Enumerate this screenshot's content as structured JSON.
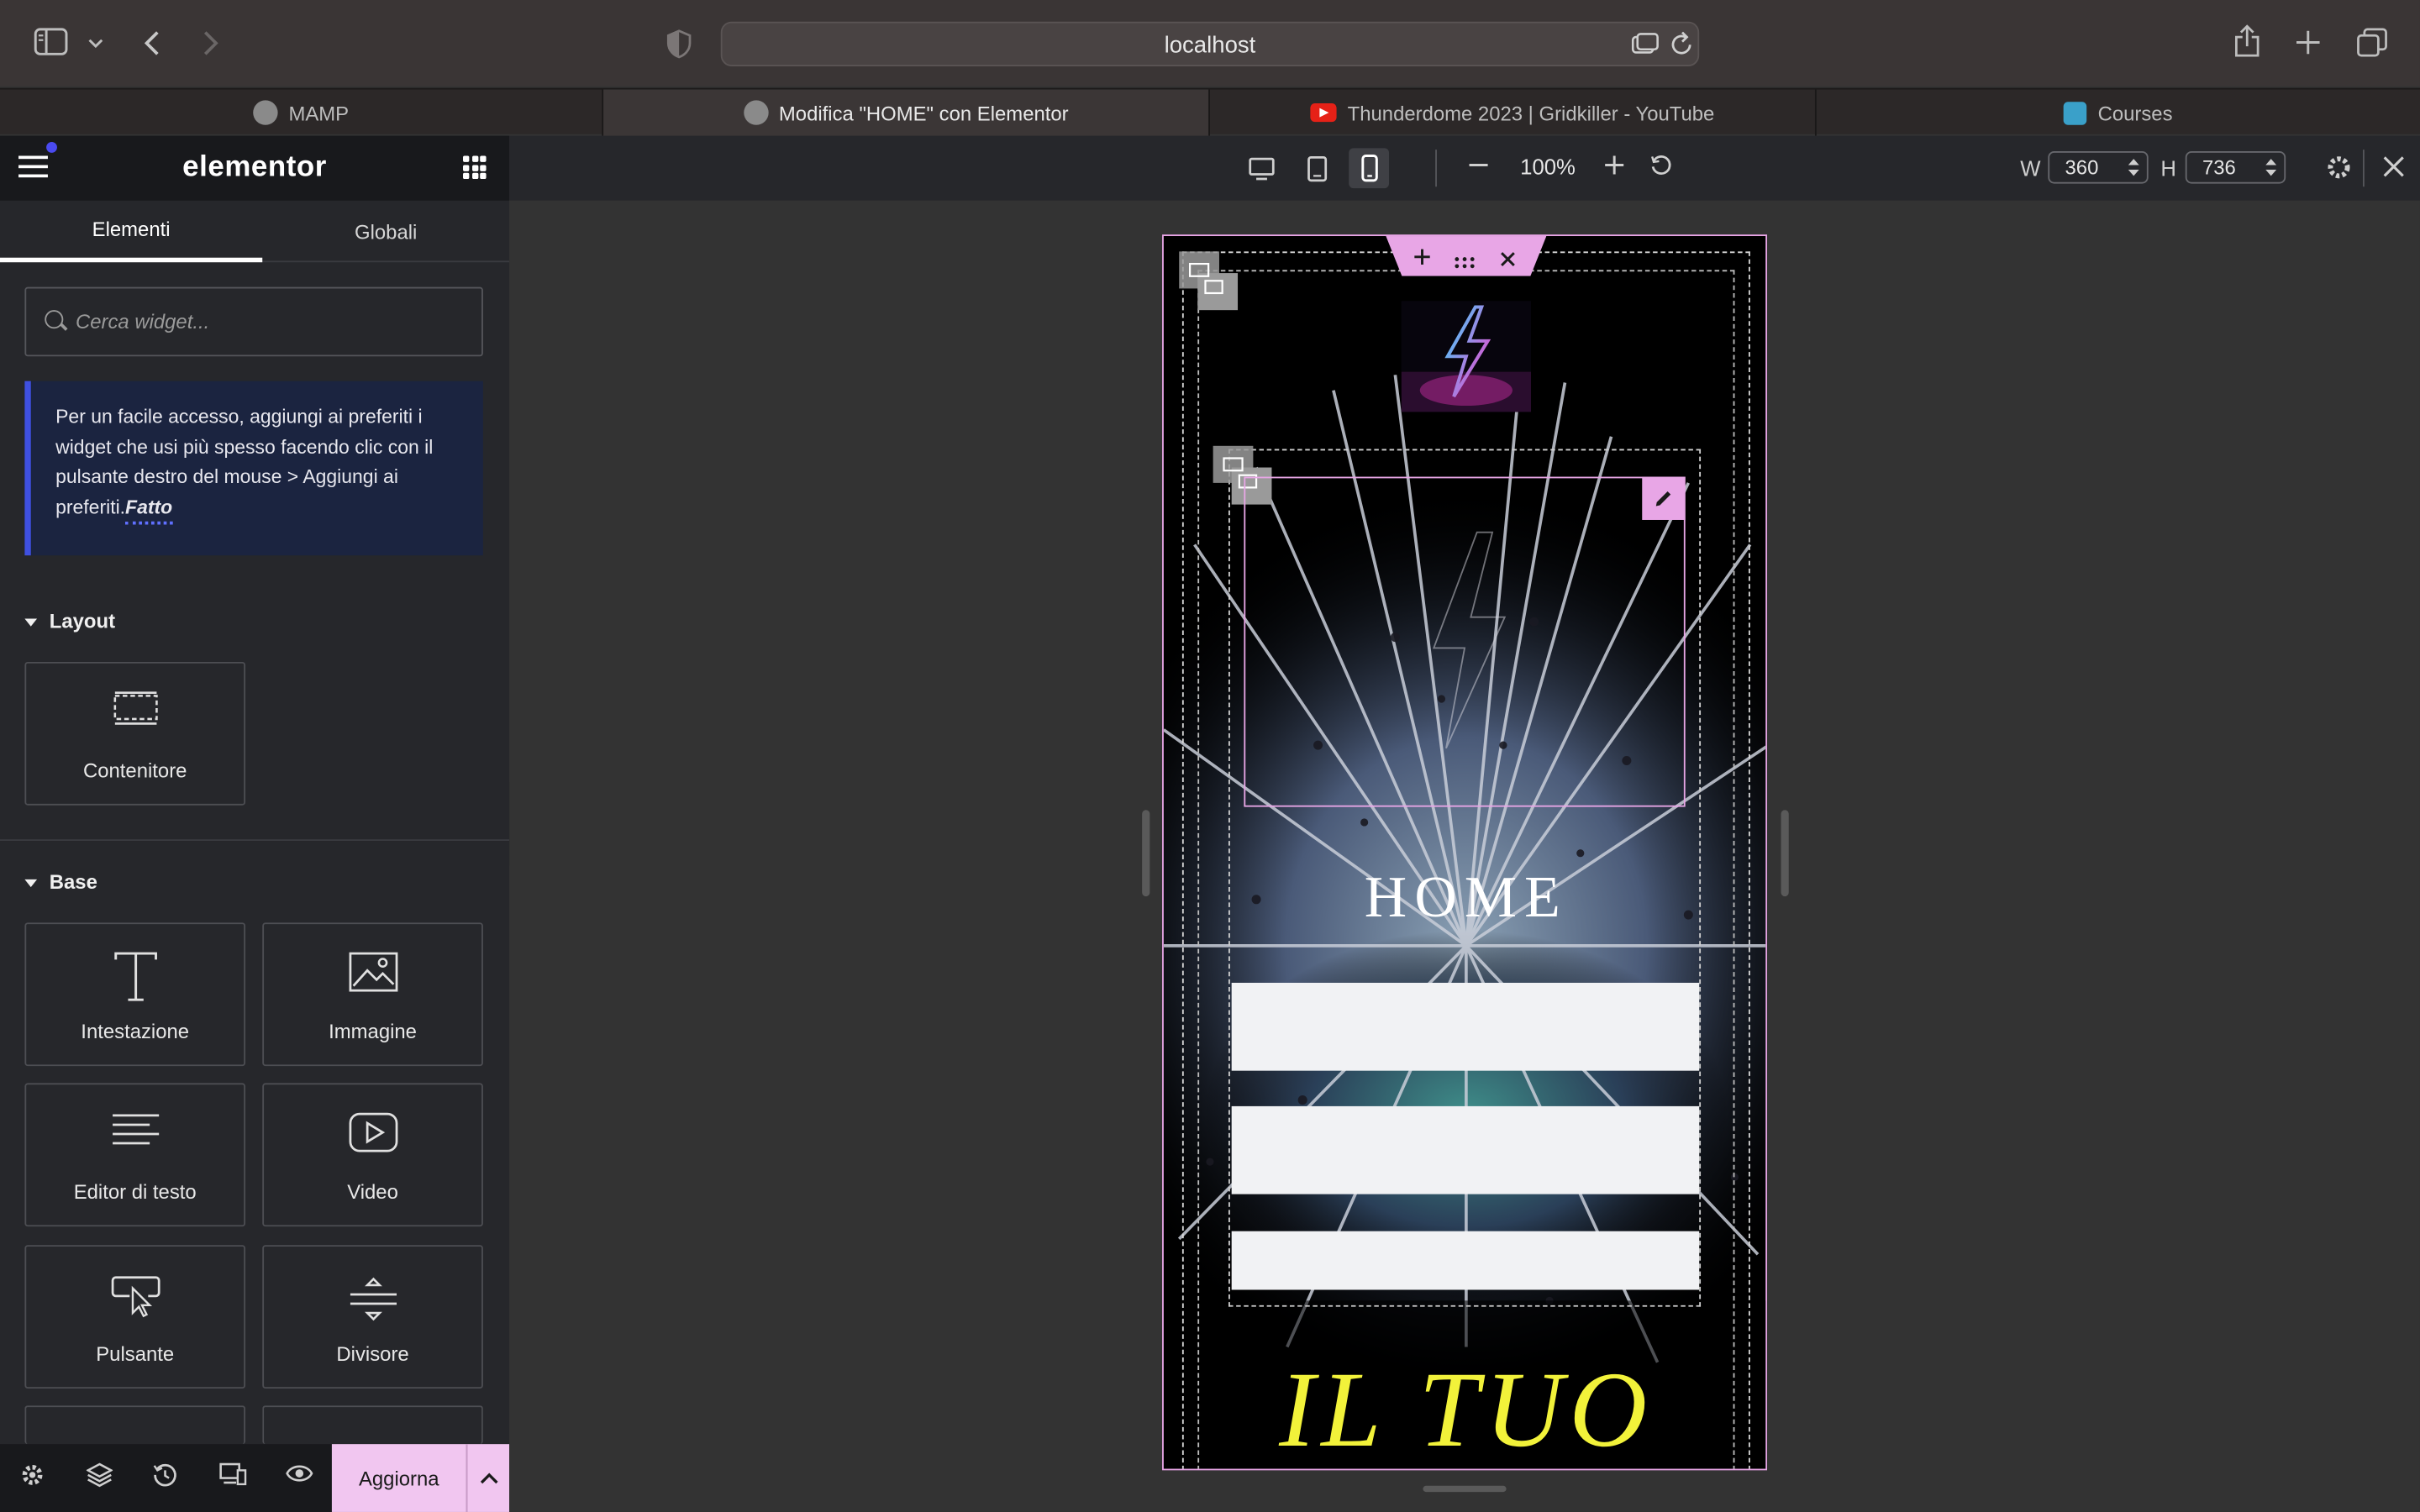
{
  "browser": {
    "url": "localhost",
    "tabs": [
      {
        "label": "MAMP",
        "active": false
      },
      {
        "label": "Modifica \"HOME\" con Elementor",
        "active": true
      },
      {
        "label": "Thunderdome 2023 | Gridkiller - YouTube",
        "active": false
      },
      {
        "label": "Courses",
        "active": false
      }
    ]
  },
  "panel": {
    "logo": "elementor",
    "tabs": {
      "elements": "Elementi",
      "globals": "Globali"
    },
    "search_placeholder": "Cerca widget...",
    "notice_text": "Per un facile accesso, aggiungi ai preferiti i widget che usi più spesso facendo clic con il pulsante destro del mouse > Aggiungi ai preferiti.",
    "notice_link": "Fatto",
    "sections": {
      "layout": "Layout",
      "base": "Base"
    },
    "widgets": {
      "container": "Contenitore",
      "heading": "Intestazione",
      "image": "Immagine",
      "text_editor": "Editor di testo",
      "video": "Video",
      "button": "Pulsante",
      "divider": "Divisore"
    },
    "footer": {
      "update": "Aggiorna"
    }
  },
  "toolbar": {
    "zoom": "100%",
    "width_label": "W",
    "width_value": "360",
    "height_label": "H",
    "height_value": "736"
  },
  "preview": {
    "title": "HOME",
    "headline": "IL TUO",
    "accent_color": "#f2f23a"
  }
}
